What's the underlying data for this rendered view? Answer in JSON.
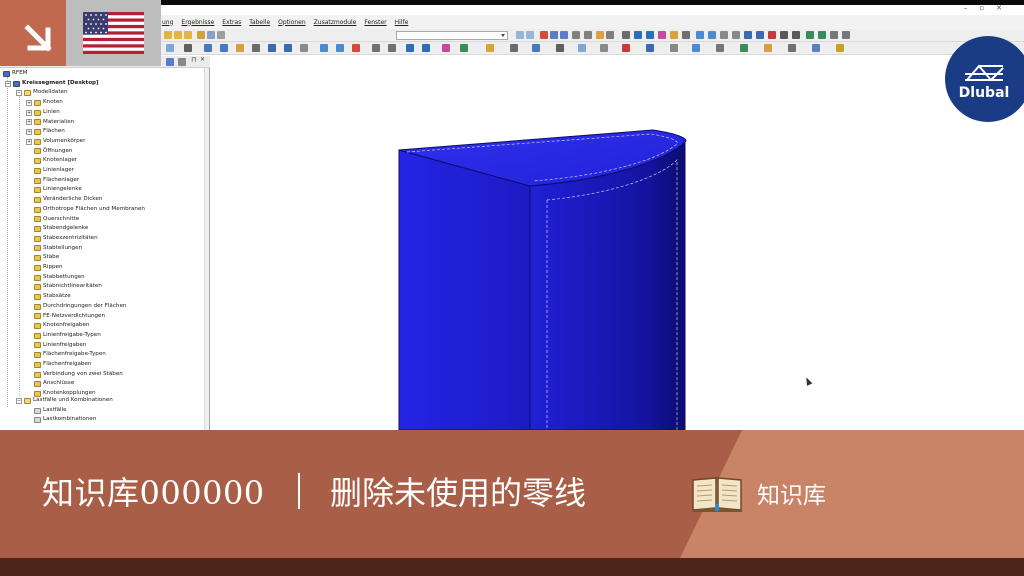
{
  "menu": {
    "items": [
      "ung",
      "Ergebnisse",
      "Extras",
      "Tabelle",
      "Optionen",
      "Zusatzmodule",
      "Fenster",
      "Hilfe"
    ]
  },
  "navigator": {
    "root": "RFEM",
    "project": "Kreissegment [Desktop]",
    "model_data": "Modelldaten",
    "items": [
      "Knoten",
      "Linien",
      "Materialien",
      "Flächen",
      "Volumenkörper",
      "Öffnungen",
      "Knotenlager",
      "Linienlager",
      "Flächenlager",
      "Liniengelenke",
      "Veränderliche Dicken",
      "Orthotrope Flächen und Membranen",
      "Querschnitte",
      "Stabendgelenke",
      "Stabexzentrizitäten",
      "Stabteilungen",
      "Stäbe",
      "Rippen",
      "Stabbettungen",
      "Stabnichtlinearitäten",
      "Stabsätze",
      "Durchdringungen der Flächen",
      "FE-Netzverdichtungen",
      "Knotenfreigaben",
      "Linienfreigabe-Typen",
      "Linienfreigaben",
      "Flächenfreigabe-Typen",
      "Flächenfreigaben",
      "Verbindung von zwei Stäben",
      "Anschlüsse",
      "Knotenkopplungen"
    ],
    "load_group": "Lastfälle und Kombinationen",
    "load_items": [
      "Lastfälle",
      "Lastkombinationen"
    ]
  },
  "logo": {
    "text": "Dlubal"
  },
  "banner": {
    "title": "知识库000000",
    "subject": "删除未使用的零线",
    "kb_label": "知识库"
  },
  "colors": {
    "banner_brown": "#a95e47",
    "banner_salmon": "#c98468",
    "footer": "#4e271a",
    "logo_blue": "#1a3c84",
    "model_blue": "#1f1fd6",
    "accent": "#c0694f"
  }
}
